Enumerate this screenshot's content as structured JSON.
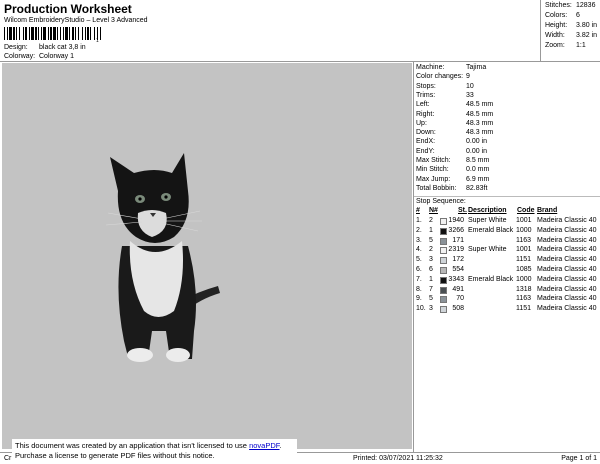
{
  "header": {
    "title": "Production Worksheet",
    "subtitle": "Wilcom EmbroideryStudio – Level 3 Advanced",
    "barcode_number": "1",
    "design_label": "Design:",
    "design_value": "black cat 3,8 in",
    "colorway_label": "Colorway:",
    "colorway_value": "Colorway 1"
  },
  "summary": [
    {
      "label": "Stitches:",
      "value": "12836"
    },
    {
      "label": "Colors:",
      "value": "6"
    },
    {
      "label": "Height:",
      "value": "3.80 in"
    },
    {
      "label": "Width:",
      "value": "3.82 in"
    },
    {
      "label": "Zoom:",
      "value": "1:1"
    }
  ],
  "properties": [
    {
      "label": "Machine:",
      "value": "Tajima"
    },
    {
      "label": "Color changes:",
      "value": "9"
    },
    {
      "label": "Stops:",
      "value": "10"
    },
    {
      "label": "Trims:",
      "value": "33"
    },
    {
      "label": "Left:",
      "value": "48.5 mm"
    },
    {
      "label": "Right:",
      "value": "48.5 mm"
    },
    {
      "label": "Up:",
      "value": "48.3 mm"
    },
    {
      "label": "Down:",
      "value": "48.3 mm"
    },
    {
      "label": "EndX:",
      "value": "0.00 in"
    },
    {
      "label": "EndY:",
      "value": "0.00 in"
    },
    {
      "label": "Max Stitch:",
      "value": "8.5 mm"
    },
    {
      "label": "Min Stitch:",
      "value": "0.0 mm"
    },
    {
      "label": "Max Jump:",
      "value": "6.9 mm"
    },
    {
      "label": "Total Bobbin:",
      "value": "82.83ft"
    }
  ],
  "stop_sequence": {
    "title": "Stop Sequence:",
    "headers": {
      "num": "#",
      "needle": "N#",
      "st": "St.",
      "desc": "Description",
      "code": "Code",
      "brand": "Brand"
    },
    "rows": [
      {
        "num": "1.",
        "needle": "2",
        "swatch": "#f2f2f2",
        "st": "1940",
        "desc": "Super White",
        "code": "1001",
        "brand": "Madeira Classic 40"
      },
      {
        "num": "2.",
        "needle": "1",
        "swatch": "#111111",
        "st": "3266",
        "desc": "Emerald Black",
        "code": "1000",
        "brand": "Madeira Classic 40"
      },
      {
        "num": "3.",
        "needle": "5",
        "swatch": "#8a9298",
        "st": "171",
        "desc": "",
        "code": "1163",
        "brand": "Madeira Classic 40"
      },
      {
        "num": "4.",
        "needle": "2",
        "swatch": "#f2f2f2",
        "st": "2319",
        "desc": "Super White",
        "code": "1001",
        "brand": "Madeira Classic 40"
      },
      {
        "num": "5.",
        "needle": "3",
        "swatch": "#cfd4d8",
        "st": "172",
        "desc": "",
        "code": "1151",
        "brand": "Madeira Classic 40"
      },
      {
        "num": "6.",
        "needle": "6",
        "swatch": "#b8b8b8",
        "st": "554",
        "desc": "",
        "code": "1085",
        "brand": "Madeira Classic 40"
      },
      {
        "num": "7.",
        "needle": "1",
        "swatch": "#111111",
        "st": "3343",
        "desc": "Emerald Black",
        "code": "1000",
        "brand": "Madeira Classic 40"
      },
      {
        "num": "8.",
        "needle": "7",
        "swatch": "#4a4f52",
        "st": "491",
        "desc": "",
        "code": "1318",
        "brand": "Madeira Classic 40"
      },
      {
        "num": "9.",
        "needle": "5",
        "swatch": "#8a9298",
        "st": "70",
        "desc": "",
        "code": "1163",
        "brand": "Madeira Classic 40"
      },
      {
        "num": "10.",
        "needle": "3",
        "swatch": "#cfd4d8",
        "st": "508",
        "desc": "",
        "code": "1151",
        "brand": "Madeira Classic 40"
      }
    ]
  },
  "footer": {
    "cr": "Cr",
    "printed": "Printed: 03/07/2021 11:25:32",
    "page": "Page 1 of 1"
  },
  "notice": {
    "line1_prefix": "This document was created by an application that isn't licensed to use ",
    "link": "novaPDF",
    "line1_suffix": ".",
    "line2": "Purchase a license to generate PDF files without this notice."
  }
}
